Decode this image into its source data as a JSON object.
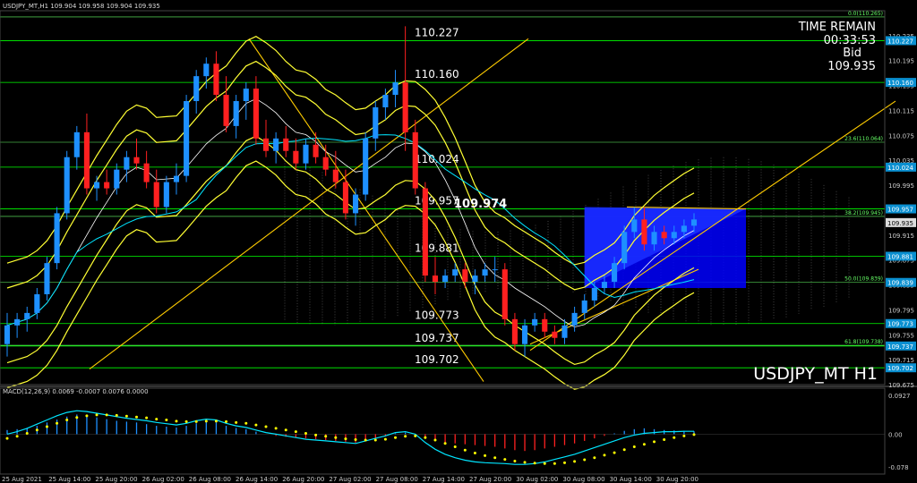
{
  "header": {
    "title": "USDJPY_MT,H1  109.904 109.958 109.904 109.935"
  },
  "info": {
    "time_remain_label": "TIME REMAIN",
    "time_remain": "00:33:53",
    "bid_label": "Bid",
    "bid_value": "109.935"
  },
  "symbol_label": "USDJPY_MT H1",
  "macd_label": "MACD(12,26,9) 0.0069 -0.0007 0.0076 0.0000",
  "colors": {
    "bull": "#1e90ff",
    "bear": "#ff2020",
    "level": "#00ff00",
    "level_label": "#00bfff",
    "band": "#ffff33",
    "trend": "#ffcc00",
    "ma_cyan": "#00e5ff",
    "ma_white": "#ffffff",
    "fill_blue": "#0000ff",
    "grid": "#1a3a1a",
    "signal": "#ffff00"
  },
  "chart_data": [
    {
      "type": "candlestick",
      "title": "USDJPY_MT,H1",
      "ylim": [
        109.675,
        110.275
      ],
      "y_ticks": [
        110.235,
        110.195,
        110.155,
        110.115,
        110.075,
        110.035,
        109.995,
        109.955,
        109.915,
        109.875,
        109.835,
        109.795,
        109.755,
        109.715,
        109.675
      ],
      "x_ticks": [
        "25 Aug 2021",
        "25 Aug 14:00",
        "25 Aug 20:00",
        "26 Aug 02:00",
        "26 Aug 08:00",
        "26 Aug 14:00",
        "26 Aug 20:00",
        "27 Aug 02:00",
        "27 Aug 08:00",
        "27 Aug 14:00",
        "27 Aug 20:00",
        "30 Aug 02:00",
        "30 Aug 08:00",
        "30 Aug 14:00",
        "30 Aug 20:00"
      ],
      "candles": [
        [
          109.74,
          109.79,
          109.72,
          109.77
        ],
        [
          109.77,
          109.79,
          109.75,
          109.78
        ],
        [
          109.78,
          109.8,
          109.76,
          109.79
        ],
        [
          109.79,
          109.83,
          109.78,
          109.82
        ],
        [
          109.82,
          109.88,
          109.81,
          109.87
        ],
        [
          109.87,
          109.96,
          109.86,
          109.95
        ],
        [
          109.95,
          110.05,
          109.94,
          110.04
        ],
        [
          110.04,
          110.09,
          110.02,
          110.08
        ],
        [
          110.08,
          110.11,
          109.98,
          109.99
        ],
        [
          109.99,
          110.01,
          109.97,
          110.0
        ],
        [
          110.0,
          110.02,
          109.98,
          109.99
        ],
        [
          109.99,
          110.03,
          109.98,
          110.02
        ],
        [
          110.02,
          110.05,
          110.0,
          110.04
        ],
        [
          110.04,
          110.07,
          110.02,
          110.03
        ],
        [
          110.03,
          110.05,
          109.99,
          110.0
        ],
        [
          110.0,
          110.02,
          109.95,
          109.96
        ],
        [
          109.96,
          110.01,
          109.95,
          110.0
        ],
        [
          110.0,
          110.03,
          109.98,
          110.01
        ],
        [
          110.01,
          110.14,
          110.0,
          110.13
        ],
        [
          110.13,
          110.18,
          110.11,
          110.17
        ],
        [
          110.17,
          110.2,
          110.15,
          110.19
        ],
        [
          110.19,
          110.21,
          110.13,
          110.14
        ],
        [
          110.14,
          110.17,
          110.08,
          110.09
        ],
        [
          110.09,
          110.14,
          110.07,
          110.13
        ],
        [
          110.13,
          110.16,
          110.1,
          110.15
        ],
        [
          110.15,
          110.17,
          110.06,
          110.07
        ],
        [
          110.07,
          110.1,
          110.04,
          110.05
        ],
        [
          110.05,
          110.08,
          110.03,
          110.07
        ],
        [
          110.07,
          110.09,
          110.04,
          110.05
        ],
        [
          110.05,
          110.07,
          110.02,
          110.03
        ],
        [
          110.03,
          110.07,
          110.02,
          110.06
        ],
        [
          110.06,
          110.08,
          110.03,
          110.04
        ],
        [
          110.04,
          110.06,
          110.01,
          110.02
        ],
        [
          110.02,
          110.05,
          109.99,
          110.0
        ],
        [
          110.0,
          110.02,
          109.94,
          109.95
        ],
        [
          109.95,
          109.99,
          109.93,
          109.98
        ],
        [
          109.98,
          110.08,
          109.97,
          110.07
        ],
        [
          110.07,
          110.13,
          110.05,
          110.12
        ],
        [
          110.12,
          110.15,
          110.1,
          110.14
        ],
        [
          110.14,
          110.18,
          110.12,
          110.16
        ],
        [
          110.16,
          110.25,
          110.05,
          110.08
        ],
        [
          110.08,
          110.1,
          109.98,
          109.99
        ],
        [
          109.99,
          110.0,
          109.84,
          109.85
        ],
        [
          109.85,
          109.88,
          109.82,
          109.84
        ],
        [
          109.84,
          109.86,
          109.83,
          109.85
        ],
        [
          109.85,
          109.87,
          109.84,
          109.86
        ],
        [
          109.86,
          109.87,
          109.83,
          109.84
        ],
        [
          109.84,
          109.86,
          109.82,
          109.85
        ],
        [
          109.85,
          109.87,
          109.84,
          109.86
        ],
        [
          109.86,
          109.88,
          109.84,
          109.86
        ],
        [
          109.86,
          109.87,
          109.77,
          109.78
        ],
        [
          109.78,
          109.79,
          109.73,
          109.74
        ],
        [
          109.74,
          109.78,
          109.72,
          109.77
        ],
        [
          109.77,
          109.79,
          109.76,
          109.78
        ],
        [
          109.78,
          109.79,
          109.75,
          109.76
        ],
        [
          109.76,
          109.77,
          109.74,
          109.75
        ],
        [
          109.75,
          109.78,
          109.74,
          109.77
        ],
        [
          109.77,
          109.8,
          109.76,
          109.79
        ],
        [
          109.79,
          109.82,
          109.78,
          109.81
        ],
        [
          109.81,
          109.84,
          109.8,
          109.83
        ],
        [
          109.83,
          109.85,
          109.82,
          109.84
        ],
        [
          109.84,
          109.88,
          109.83,
          109.87
        ],
        [
          109.87,
          109.93,
          109.86,
          109.92
        ],
        [
          109.92,
          109.96,
          109.91,
          109.94
        ],
        [
          109.94,
          109.96,
          109.89,
          109.9
        ],
        [
          109.9,
          109.93,
          109.89,
          109.92
        ],
        [
          109.92,
          109.93,
          109.9,
          109.91
        ],
        [
          109.91,
          109.93,
          109.9,
          109.92
        ],
        [
          109.92,
          109.94,
          109.91,
          109.93
        ],
        [
          109.93,
          109.95,
          109.92,
          109.94
        ]
      ],
      "levels": [
        {
          "value": 110.227,
          "label": "110.227"
        },
        {
          "value": 110.16,
          "label": "110.160"
        },
        {
          "value": 110.024,
          "label": "110.024"
        },
        {
          "value": 109.957,
          "label": "109.957"
        },
        {
          "value": 109.881,
          "label": "109.881"
        },
        {
          "value": 109.773,
          "label": "109.773"
        },
        {
          "value": 109.737,
          "label": "109.737"
        },
        {
          "value": 109.702,
          "label": "109.702"
        }
      ],
      "fib_levels": [
        {
          "value": 110.265,
          "label": "0.0(110.265)"
        },
        {
          "value": 110.064,
          "label": "23.6(110.064)"
        },
        {
          "value": 109.945,
          "label": "38.2(109.945)"
        },
        {
          "value": 109.839,
          "label": "50.0(109.839)"
        },
        {
          "value": 109.738,
          "label": "61.8(109.738)"
        }
      ],
      "annotation": "109.974",
      "current_price": "109.935",
      "price_tags": [
        "110.227",
        "110.160",
        "110.024",
        "109.957",
        "109.935",
        "109.881",
        "109.839",
        "109.773",
        "109.737",
        "109.702"
      ]
    },
    {
      "type": "bar",
      "title": "MACD(12,26,9) 0.0069 -0.0007 0.0076 0.0000",
      "ylim": [
        -0.078,
        0.0927
      ],
      "y_ticks": [
        0.0927,
        0.0,
        -0.078
      ],
      "histogram": [
        0.01,
        0.012,
        0.015,
        0.02,
        0.028,
        0.035,
        0.042,
        0.047,
        0.045,
        0.04,
        0.036,
        0.032,
        0.03,
        0.028,
        0.024,
        0.02,
        0.018,
        0.016,
        0.02,
        0.026,
        0.03,
        0.028,
        0.02,
        0.015,
        0.012,
        0.006,
        0.0,
        -0.004,
        -0.006,
        -0.008,
        -0.01,
        -0.012,
        -0.014,
        -0.016,
        -0.018,
        -0.02,
        -0.015,
        -0.01,
        -0.005,
        0.002,
        0.004,
        0.0,
        -0.01,
        -0.016,
        -0.02,
        -0.022,
        -0.024,
        -0.026,
        -0.028,
        -0.03,
        -0.034,
        -0.038,
        -0.04,
        -0.038,
        -0.034,
        -0.03,
        -0.026,
        -0.022,
        -0.016,
        -0.01,
        -0.004,
        0.002,
        0.008,
        0.012,
        0.014,
        0.012,
        0.01,
        0.009,
        0.008,
        0.007
      ],
      "macd": [
        0.0,
        0.006,
        0.014,
        0.024,
        0.034,
        0.044,
        0.052,
        0.056,
        0.054,
        0.05,
        0.046,
        0.042,
        0.038,
        0.035,
        0.032,
        0.028,
        0.025,
        0.022,
        0.026,
        0.032,
        0.036,
        0.034,
        0.026,
        0.02,
        0.016,
        0.01,
        0.004,
        0.0,
        -0.004,
        -0.008,
        -0.012,
        -0.014,
        -0.016,
        -0.018,
        -0.02,
        -0.022,
        -0.016,
        -0.01,
        -0.004,
        0.004,
        0.006,
        0.0,
        -0.02,
        -0.036,
        -0.048,
        -0.056,
        -0.062,
        -0.066,
        -0.068,
        -0.069,
        -0.07,
        -0.072,
        -0.072,
        -0.07,
        -0.066,
        -0.06,
        -0.054,
        -0.048,
        -0.04,
        -0.032,
        -0.024,
        -0.016,
        -0.008,
        -0.002,
        0.002,
        0.004,
        0.006,
        0.006,
        0.007,
        0.007
      ],
      "signal": [
        -0.01,
        -0.005,
        0.002,
        0.01,
        0.018,
        0.026,
        0.034,
        0.04,
        0.044,
        0.046,
        0.046,
        0.045,
        0.043,
        0.041,
        0.039,
        0.036,
        0.034,
        0.031,
        0.03,
        0.03,
        0.031,
        0.031,
        0.03,
        0.028,
        0.026,
        0.022,
        0.018,
        0.014,
        0.01,
        0.006,
        0.002,
        -0.002,
        -0.005,
        -0.008,
        -0.011,
        -0.013,
        -0.014,
        -0.014,
        -0.012,
        -0.008,
        -0.005,
        -0.004,
        -0.008,
        -0.014,
        -0.022,
        -0.03,
        -0.038,
        -0.045,
        -0.051,
        -0.056,
        -0.06,
        -0.064,
        -0.067,
        -0.069,
        -0.07,
        -0.07,
        -0.068,
        -0.065,
        -0.061,
        -0.056,
        -0.05,
        -0.044,
        -0.037,
        -0.03,
        -0.024,
        -0.018,
        -0.013,
        -0.008,
        -0.004,
        -0.001
      ]
    }
  ]
}
